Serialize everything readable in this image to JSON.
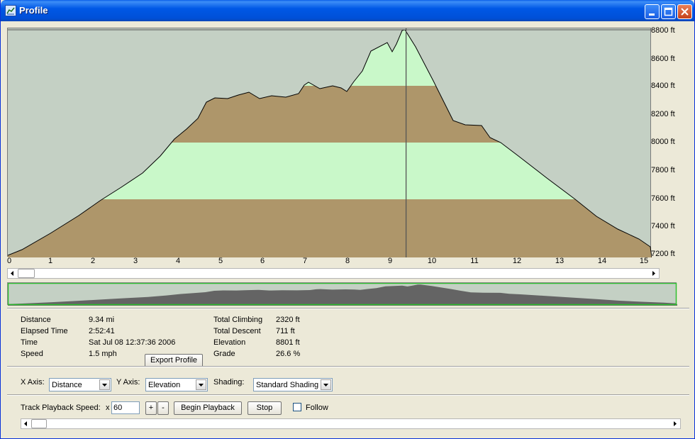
{
  "window": {
    "title": "Profile"
  },
  "plot": {
    "y_ticks": [
      "8800 ft",
      "8600 ft",
      "8400 ft",
      "8200 ft",
      "8000 ft",
      "7800 ft",
      "7600 ft",
      "7400 ft",
      "7200 ft"
    ],
    "x_ticks": [
      "0",
      "1",
      "2",
      "3",
      "4",
      "5",
      "6",
      "7",
      "8",
      "9",
      "10",
      "11",
      "12",
      "13",
      "14",
      "15"
    ],
    "cursor_distance_mi": 9.34,
    "colors": {
      "background": "#c4d0c4",
      "band_brown": "#ae966a",
      "band_green": "#c9f8c9",
      "line": "#000000"
    }
  },
  "stats": {
    "distance": {
      "label": "Distance",
      "value": "9.34 mi"
    },
    "elapsed": {
      "label": "Elapsed Time",
      "value": "2:52:41"
    },
    "time": {
      "label": "Time",
      "value": "Sat Jul 08 12:37:36 2006"
    },
    "speed": {
      "label": "Speed",
      "value": "1.5 mph"
    },
    "climbing": {
      "label": "Total Climbing",
      "value": "2320 ft"
    },
    "descent": {
      "label": "Total Descent",
      "value": "711 ft"
    },
    "elevation": {
      "label": "Elevation",
      "value": "8801 ft"
    },
    "grade": {
      "label": "Grade",
      "value": "26.6 %"
    }
  },
  "export_button": "Export Profile",
  "axes": {
    "x_label": "X Axis:",
    "x_value": "Distance",
    "y_label": "Y Axis:",
    "y_value": "Elevation",
    "shading_label": "Shading:",
    "shading_value": "Standard Shading"
  },
  "playback": {
    "speed_label": "Track Playback Speed:",
    "multiplier": "x",
    "speed_value": "60",
    "plus": "+",
    "minus": "-",
    "begin": "Begin Playback",
    "stop": "Stop",
    "follow": "Follow"
  }
}
